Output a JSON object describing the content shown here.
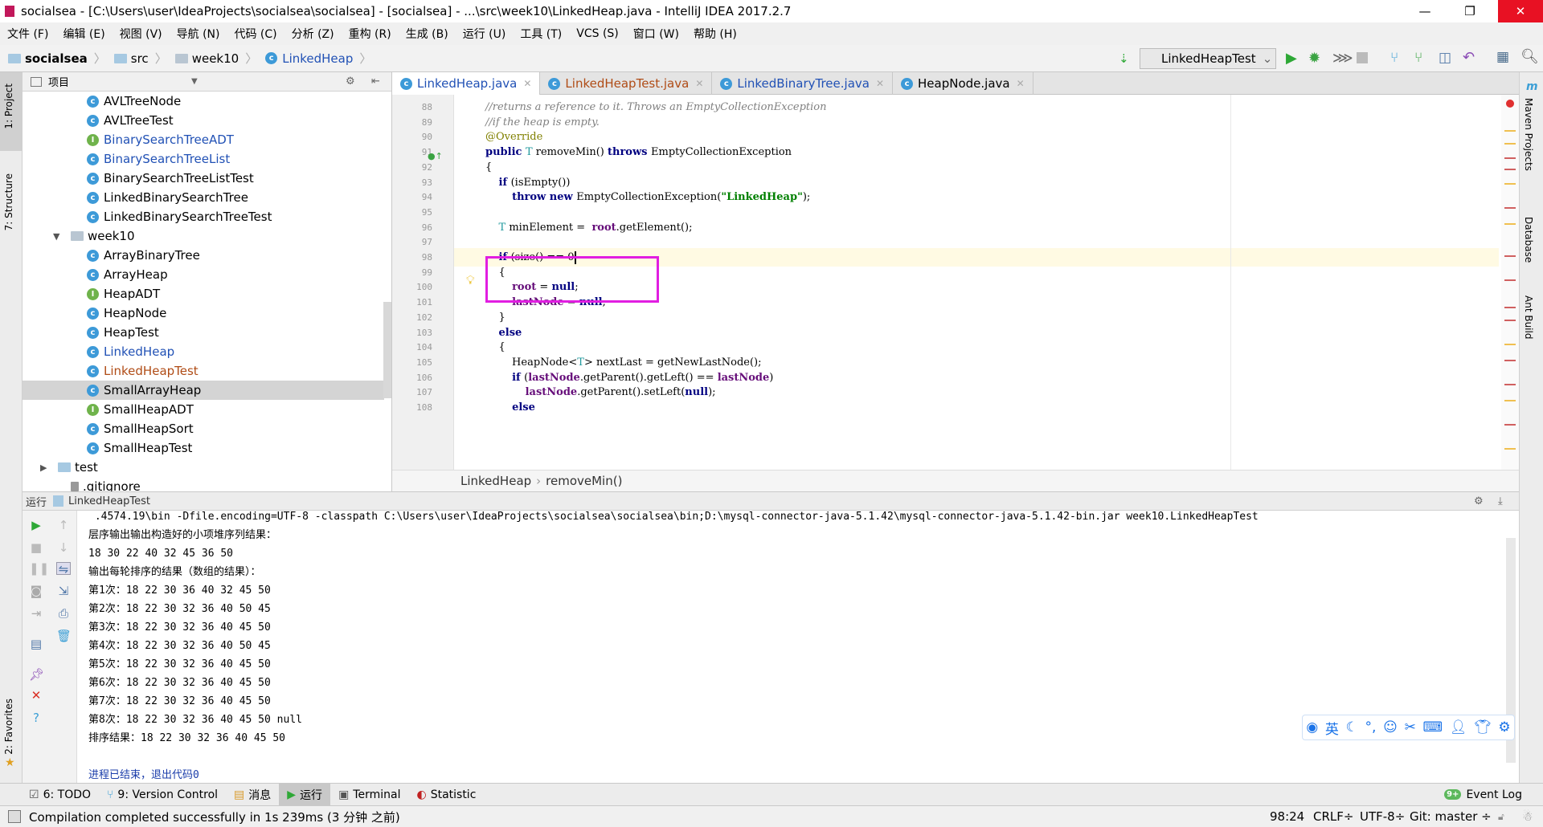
{
  "window": {
    "title": "socialsea - [C:\\Users\\user\\IdeaProjects\\socialsea\\socialsea] - [socialsea] - ...\\src\\week10\\LinkedHeap.java - IntelliJ IDEA 2017.2.7"
  },
  "menu": [
    "文件 (F)",
    "编辑 (E)",
    "视图 (V)",
    "导航 (N)",
    "代码 (C)",
    "分析 (Z)",
    "重构 (R)",
    "生成 (B)",
    "运行 (U)",
    "工具 (T)",
    "VCS (S)",
    "窗口 (W)",
    "帮助 (H)"
  ],
  "breadcrumb": [
    "socialsea",
    "src",
    "week10",
    "LinkedHeap"
  ],
  "run_config": "LinkedHeapTest",
  "left_strip": {
    "project": "1: Project",
    "structure": "7: Structure",
    "favorites": "2: Favorites"
  },
  "right_strip": {
    "maven": "Maven Projects",
    "database": "Database",
    "ant": "Ant Build"
  },
  "project_panel": {
    "title": "项目",
    "items": [
      {
        "label": "AVLTreeNode",
        "icon": "class",
        "depth": 2
      },
      {
        "label": "AVLTreeTest",
        "icon": "class",
        "depth": 2
      },
      {
        "label": "BinarySearchTreeADT",
        "icon": "interface",
        "depth": 2,
        "color": "#2151b5"
      },
      {
        "label": "BinarySearchTreeList",
        "icon": "class",
        "depth": 2,
        "color": "#2151b5"
      },
      {
        "label": "BinarySearchTreeListTest",
        "icon": "class",
        "depth": 2
      },
      {
        "label": "LinkedBinarySearchTree",
        "icon": "class",
        "depth": 2
      },
      {
        "label": "LinkedBinarySearchTreeTest",
        "icon": "class",
        "depth": 2
      },
      {
        "label": "week10",
        "icon": "folder",
        "depth": 1,
        "expanded": true
      },
      {
        "label": "ArrayBinaryTree",
        "icon": "class",
        "depth": 2
      },
      {
        "label": "ArrayHeap",
        "icon": "class",
        "depth": 2
      },
      {
        "label": "HeapADT",
        "icon": "interface",
        "depth": 2
      },
      {
        "label": "HeapNode",
        "icon": "class",
        "depth": 2
      },
      {
        "label": "HeapTest",
        "icon": "class",
        "depth": 2
      },
      {
        "label": "LinkedHeap",
        "icon": "class",
        "depth": 2,
        "color": "#2151b5"
      },
      {
        "label": "LinkedHeapTest",
        "icon": "class",
        "depth": 2,
        "color": "#b04c16"
      },
      {
        "label": "SmallArrayHeap",
        "icon": "class",
        "depth": 2,
        "selected": true
      },
      {
        "label": "SmallHeapADT",
        "icon": "interface",
        "depth": 2
      },
      {
        "label": "SmallHeapSort",
        "icon": "class",
        "depth": 2
      },
      {
        "label": "SmallHeapTest",
        "icon": "class",
        "depth": 2
      },
      {
        "label": "test",
        "icon": "folder",
        "depth": 0,
        "expanded": false
      },
      {
        "label": ".gitignore",
        "icon": "file",
        "depth": 1
      }
    ]
  },
  "tabs": [
    {
      "label": "LinkedHeap.java",
      "active": true,
      "color": "#2151b5"
    },
    {
      "label": "LinkedHeapTest.java",
      "color": "#b04c16"
    },
    {
      "label": "LinkedBinaryTree.java",
      "color": "#2151b5"
    },
    {
      "label": "HeapNode.java",
      "color": "#000000"
    }
  ],
  "editor": {
    "lines": [
      {
        "n": "88",
        "tokens": [
          [
            "cm",
            "//returns a reference to it. Throws an EmptyCollectionException"
          ]
        ]
      },
      {
        "n": "89",
        "tokens": [
          [
            "cm",
            "//if the heap is empty."
          ]
        ]
      },
      {
        "n": "90",
        "tokens": [
          [
            "an",
            "@Override"
          ]
        ]
      },
      {
        "n": "91",
        "tokens": [
          [
            "kw",
            "public "
          ],
          [
            "tp",
            "T "
          ],
          [
            "",
            "removeMin() "
          ],
          [
            "kw",
            "throws "
          ],
          [
            "",
            "EmptyCollectionException"
          ]
        ]
      },
      {
        "n": "92",
        "tokens": [
          [
            "",
            "{"
          ]
        ]
      },
      {
        "n": "93",
        "tokens": [
          [
            "",
            "    "
          ],
          [
            "kw",
            "if "
          ],
          [
            "",
            "(isEmpty())"
          ]
        ]
      },
      {
        "n": "94",
        "tokens": [
          [
            "",
            "        "
          ],
          [
            "kw",
            "throw new "
          ],
          [
            "",
            "EmptyCollectionException("
          ],
          [
            "st",
            "\"LinkedHeap\""
          ],
          [
            "",
            ");"
          ]
        ]
      },
      {
        "n": "95",
        "tokens": []
      },
      {
        "n": "96",
        "tokens": [
          [
            "",
            "    "
          ],
          [
            "tp",
            "T "
          ],
          [
            "",
            "minElement =  "
          ],
          [
            "fd",
            "root"
          ],
          [
            "",
            ".getElement();"
          ]
        ]
      },
      {
        "n": "97",
        "tokens": []
      },
      {
        "n": "98",
        "tokens": [
          [
            "",
            "    "
          ],
          [
            "kw",
            "if "
          ],
          [
            "",
            "(size() == 0"
          ]
        ],
        "current": true
      },
      {
        "n": "99",
        "tokens": [
          [
            "",
            "    {"
          ]
        ]
      },
      {
        "n": "100",
        "tokens": [
          [
            "",
            "        "
          ],
          [
            "fd",
            "root"
          ],
          [
            "",
            " = "
          ],
          [
            "kw",
            "null"
          ],
          [
            "",
            ";"
          ]
        ]
      },
      {
        "n": "101",
        "tokens": [
          [
            "",
            "        "
          ],
          [
            "fd",
            "lastNode"
          ],
          [
            "",
            " = "
          ],
          [
            "kw",
            "null"
          ],
          [
            "",
            ";"
          ]
        ]
      },
      {
        "n": "102",
        "tokens": [
          [
            "",
            "    }"
          ]
        ]
      },
      {
        "n": "103",
        "tokens": [
          [
            "",
            "    "
          ],
          [
            "kw",
            "else"
          ]
        ]
      },
      {
        "n": "104",
        "tokens": [
          [
            "",
            "    {"
          ]
        ]
      },
      {
        "n": "105",
        "tokens": [
          [
            "",
            "        HeapNode<"
          ],
          [
            "tp",
            "T"
          ],
          [
            "",
            "> nextLast = getNewLastNode();"
          ]
        ]
      },
      {
        "n": "106",
        "tokens": [
          [
            "",
            "        "
          ],
          [
            "kw",
            "if "
          ],
          [
            "",
            "("
          ],
          [
            "fd",
            "lastNode"
          ],
          [
            "",
            ".getParent().getLeft() == "
          ],
          [
            "fd",
            "lastNode"
          ],
          [
            "",
            ")"
          ]
        ]
      },
      {
        "n": "107",
        "tokens": [
          [
            "",
            "            "
          ],
          [
            "fd",
            "lastNode"
          ],
          [
            "",
            ".getParent().setLeft("
          ],
          [
            "kw",
            "null"
          ],
          [
            "",
            ");"
          ]
        ]
      },
      {
        "n": "108",
        "tokens": [
          [
            "",
            "        "
          ],
          [
            "kw",
            "else"
          ]
        ]
      }
    ],
    "breadcrumb": [
      "LinkedHeap",
      "removeMin()"
    ]
  },
  "run_panel": {
    "label": "运行",
    "config": "LinkedHeapTest",
    "console": [
      " .4574.19\\bin -Dfile.encoding=UTF-8 -classpath C:\\Users\\user\\IdeaProjects\\socialsea\\socialsea\\bin;D:\\mysql-connector-java-5.1.42\\mysql-connector-java-5.1.42-bin.jar week10.LinkedHeapTest",
      "层序输出输出构造好的小项堆序列结果：",
      "18 30 22 40 32 45 36 50",
      "输出每轮排序的结果（数组的结果）：",
      "第1次：18 22 30 36 40 32 45 50",
      "第2次：18 22 30 32 36 40 50 45",
      "第3次：18 22 30 32 36 40 45 50",
      "第4次：18 22 30 32 36 40 50 45",
      "第5次：18 22 30 32 36 40 45 50",
      "第6次：18 22 30 32 36 40 45 50",
      "第7次：18 22 30 32 36 40 45 50",
      "第8次：18 22 30 32 36 40 45 50 null",
      "排序结果：18 22 30 32 36 40 45 50",
      "",
      "进程已结束，退出代码0"
    ]
  },
  "bottom_tools": [
    {
      "label": "6: TODO",
      "icon": "todo-icon"
    },
    {
      "label": "9: Version Control",
      "icon": "version-control-icon"
    },
    {
      "label": "消息",
      "icon": "messages-icon"
    },
    {
      "label": "运行",
      "icon": "run-icon",
      "active": true
    },
    {
      "label": "Terminal",
      "icon": "terminal-icon"
    },
    {
      "label": "Statistic",
      "icon": "statistic-icon"
    }
  ],
  "event_log": {
    "badge": "9+",
    "label": "Event Log"
  },
  "status": {
    "message": "Compilation completed successfully in 1s 239ms (3 分钟 之前)",
    "position": "98:24",
    "line_sep": "CRLF÷",
    "encoding": "UTF-8÷",
    "vcs": "Git: master ÷"
  },
  "ime": {
    "lang": "英"
  },
  "colors": {
    "highlight_box": "#e11ee1",
    "current_line": "#fffae3",
    "run_green": "#2ea836"
  }
}
